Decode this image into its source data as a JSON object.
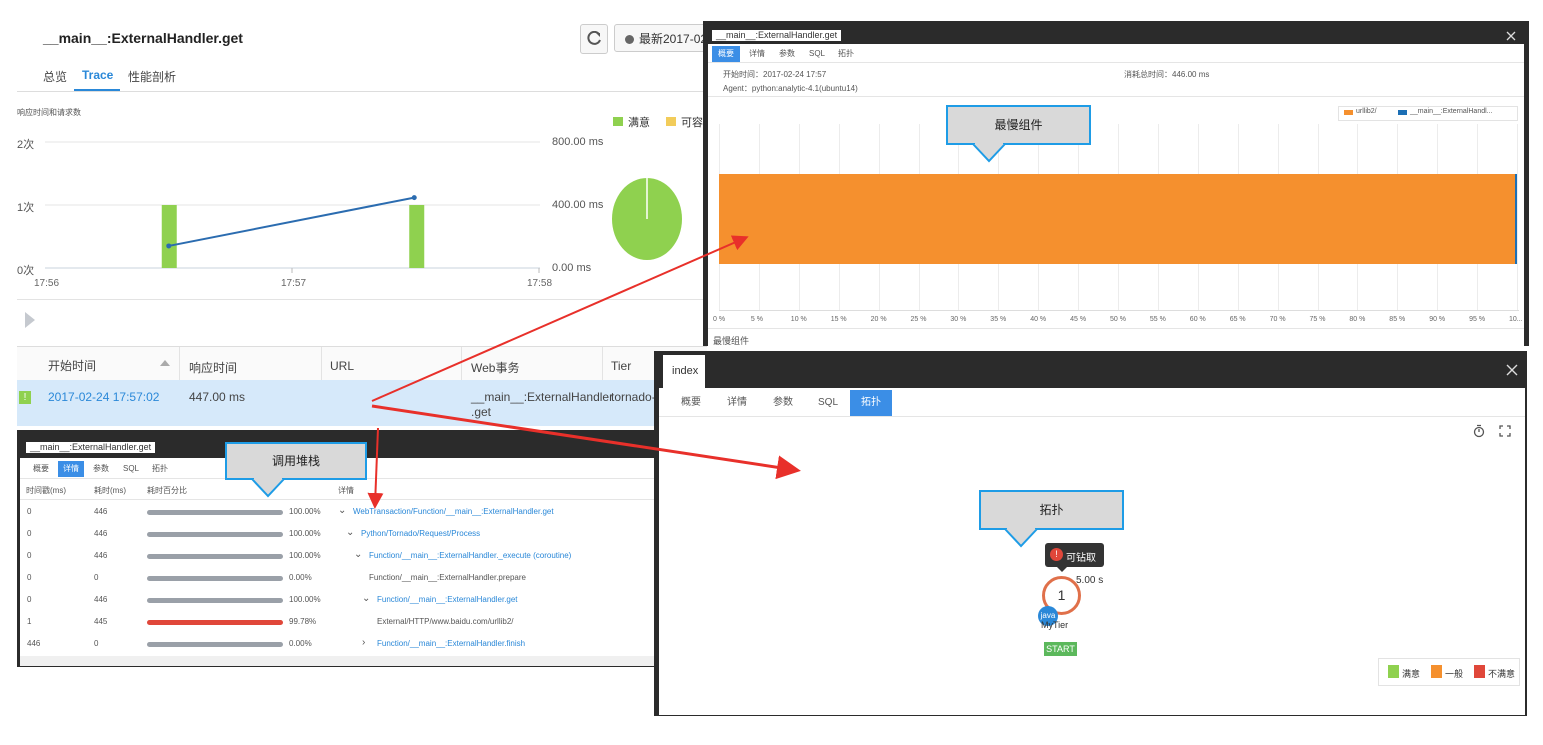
{
  "main": {
    "title": "__main__:ExternalHandler.get",
    "tabs": [
      "总览",
      "Trace",
      "性能剖析"
    ],
    "time_button": "最新2017-02",
    "chart_heading": "响应时间和请求数",
    "legend": [
      "满意",
      "可容"
    ]
  },
  "chart_data": {
    "type": "bar",
    "title": "响应时间和请求数",
    "x_ticks": [
      "17:56",
      "17:57",
      "17:58"
    ],
    "y_left_ticks": [
      "2次",
      "1次",
      "0次"
    ],
    "y_right_ticks": [
      "800.00 ms",
      "400.00 ms",
      "0.00 ms"
    ],
    "series": [
      {
        "name": "满意",
        "kind": "bar",
        "x": [
          "17:56:30",
          "17:57:30"
        ],
        "values": [
          1,
          1
        ],
        "color": "#8fd14f"
      },
      {
        "kind": "line",
        "x": [
          "17:56:30",
          "17:57:30"
        ],
        "values": [
          140,
          447
        ],
        "color": "#2b6cb0"
      }
    ],
    "ylim_left": [
      0,
      2
    ],
    "ylim_right": [
      0,
      800
    ],
    "pie": {
      "values": [
        1
      ],
      "labels": [
        "满意"
      ],
      "color": "#8fd14f"
    }
  },
  "table": {
    "headers": [
      "开始时间",
      "响应时间",
      "URL",
      "Web事务",
      "Tier"
    ],
    "row": {
      "start": "2017-02-24 17:57:02",
      "response": "447.00 ms",
      "url": "",
      "web_tx_1": "__main__:ExternalHandler",
      "web_tx_2": ".get",
      "tier": "tornado-"
    }
  },
  "panel_a": {
    "title": "__main__:ExternalHandler.get",
    "tabs": [
      "概要",
      "详情",
      "参数",
      "SQL",
      "拓扑"
    ],
    "start_label": "开始时间：",
    "start_value": "2017-02-24 17:57",
    "total_label": "消耗总时间：",
    "total_value": "446.00 ms",
    "agent_label": "Agent：",
    "agent_value": "python:analytic-4.1(ubuntu14)",
    "legend": [
      "urllib2/",
      "__main__:ExternalHandl..."
    ],
    "x_ticks": [
      "0 %",
      "5 %",
      "10 %",
      "15 %",
      "20 %",
      "25 %",
      "30 %",
      "35 %",
      "40 %",
      "45 %",
      "50 %",
      "55 %",
      "60 %",
      "65 %",
      "70 %",
      "75 %",
      "80 %",
      "85 %",
      "90 %",
      "95 %",
      "10..."
    ],
    "footer": "最慢组件",
    "bar_color": "#f5902e"
  },
  "panel_b": {
    "title": "__main__:ExternalHandler.get",
    "tabs": [
      "概要",
      "详情",
      "参数",
      "SQL",
      "拓扑"
    ],
    "headers": [
      "时间戳(ms)",
      "耗时(ms)",
      "耗时百分比",
      "详情"
    ],
    "rows": [
      {
        "ts": "0",
        "dur": "446",
        "pct": "100.00%",
        "pct_value": 100,
        "arrow": "⌄",
        "detail": "WebTransaction/Function/__main__:ExternalHandler.get",
        "link": true
      },
      {
        "ts": "0",
        "dur": "446",
        "pct": "100.00%",
        "pct_value": 100,
        "arrow": "⌄",
        "detail": "Python/Tornado/Request/Process",
        "link": true
      },
      {
        "ts": "0",
        "dur": "446",
        "pct": "100.00%",
        "pct_value": 100,
        "arrow": "⌄",
        "detail": "Function/__main__:ExternalHandler._execute (coroutine)",
        "link": true
      },
      {
        "ts": "0",
        "dur": "0",
        "pct": "0.00%",
        "pct_value": 0,
        "arrow": "",
        "detail": "Function/__main__:ExternalHandler.prepare",
        "link": false
      },
      {
        "ts": "0",
        "dur": "446",
        "pct": "100.00%",
        "pct_value": 100,
        "arrow": "⌄",
        "detail": "Function/__main__:ExternalHandler.get",
        "link": true
      },
      {
        "ts": "1",
        "dur": "445",
        "pct": "99.78%",
        "pct_value": 99.78,
        "arrow": "",
        "detail": "External/HTTP/www.baidu.com/urllib2/",
        "link": false,
        "red": true
      },
      {
        "ts": "446",
        "dur": "0",
        "pct": "0.00%",
        "pct_value": 0,
        "arrow": "›",
        "detail": "Function/__main__:ExternalHandler.finish",
        "link": true
      }
    ]
  },
  "panel_c": {
    "title": "index",
    "tabs": [
      "概要",
      "详情",
      "参数",
      "SQL",
      "拓扑"
    ],
    "tooltip": "可钻取",
    "node_count": "1",
    "node_time": "5.00 s",
    "node_badge": "java",
    "node_label": "MyTier",
    "start_label": "START",
    "legend": [
      "满意",
      "一般",
      "不满意"
    ],
    "colors": {
      "good": "#8fd14f",
      "normal": "#f5902e",
      "bad": "#e0473a"
    }
  },
  "callouts": {
    "slowest": "最慢组件",
    "stack": "调用堆栈",
    "topology": "拓扑"
  }
}
